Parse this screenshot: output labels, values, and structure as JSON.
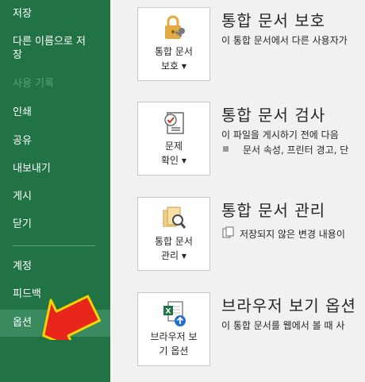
{
  "sidebar": {
    "save": "저장",
    "save_as": "다른 이름으로 저\n장",
    "history": "사용 기록",
    "print": "인쇄",
    "share": "공유",
    "export": "내보내기",
    "publish": "게시",
    "close": "닫기",
    "account": "계정",
    "feedback": "피드백",
    "options": "옵션"
  },
  "sections": {
    "protect": {
      "button_line1": "통합 문서",
      "button_line2": "보호",
      "title": "통합 문서 보호",
      "desc": "이 통합 문서에서 다른 사용자가"
    },
    "inspect": {
      "button_line1": "문제",
      "button_line2": "확인",
      "title": "통합 문서 검사",
      "desc": "이 파일을 게시하기 전에 다음",
      "bullet": "문서 속성, 프린터 경고, 단"
    },
    "manage": {
      "button_line1": "통합 문서",
      "button_line2": "관리",
      "title": "통합 문서 관리",
      "desc": "저장되지 않은 변경 내용이"
    },
    "browser": {
      "button_line1": "브라우저 보",
      "button_line2": "기 옵션",
      "title": "브라우저 보기 옵션",
      "desc": "이 통합 문서를 웹에서 볼 때 사"
    }
  },
  "colors": {
    "sidebar_bg": "#217346",
    "selected_bg": "#3a8a5f",
    "arrow_fill": "#e8251a",
    "arrow_stroke": "#f5d400"
  },
  "icons": {
    "protect": "lock-key-icon",
    "inspect": "checklist-icon",
    "manage": "document-search-icon",
    "browser": "excel-globe-icon"
  }
}
